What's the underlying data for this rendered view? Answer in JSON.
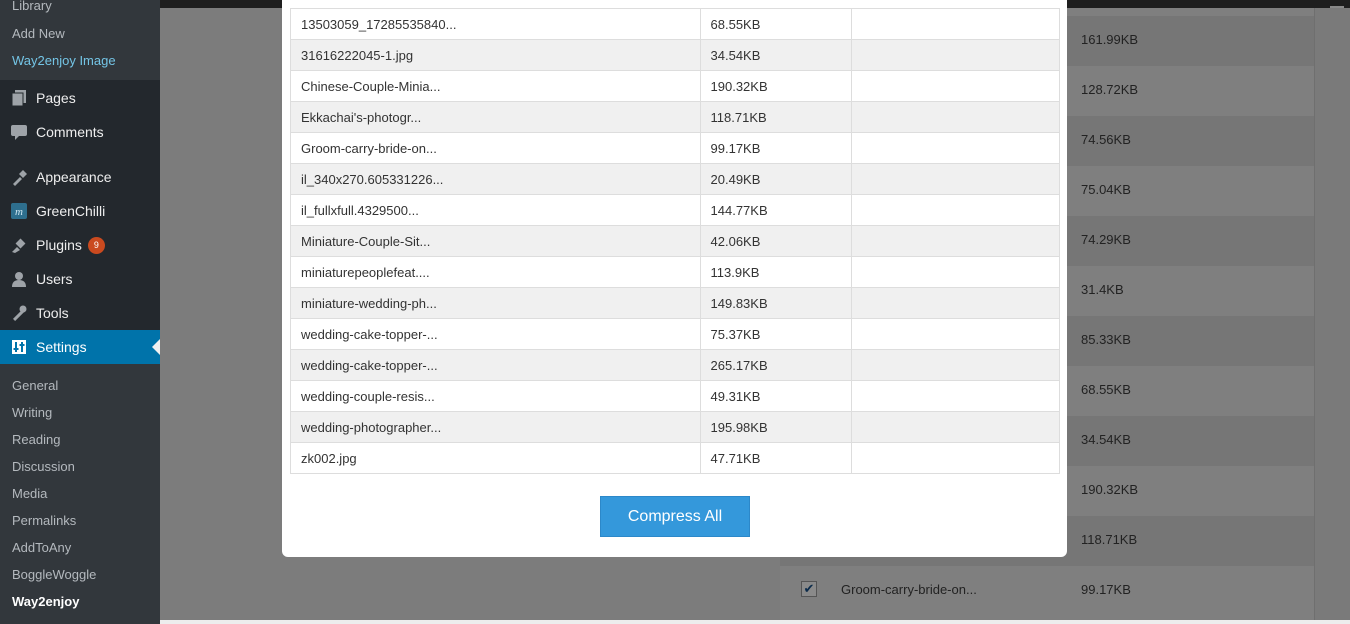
{
  "sidebar": {
    "media_sub": [
      "Library",
      "Add New",
      "Way2enjoy Image"
    ],
    "menu": [
      {
        "label": "Pages",
        "icon": "pages-icon"
      },
      {
        "label": "Comments",
        "icon": "comments-icon"
      },
      {
        "label": "Appearance",
        "icon": "appearance-icon"
      },
      {
        "label": "GreenChilli",
        "icon": "greenchilli-icon"
      },
      {
        "label": "Plugins",
        "icon": "plugins-icon",
        "badge": "9"
      },
      {
        "label": "Users",
        "icon": "users-icon"
      },
      {
        "label": "Tools",
        "icon": "tools-icon"
      },
      {
        "label": "Settings",
        "icon": "settings-icon",
        "active": true
      }
    ],
    "settings_sub": [
      "General",
      "Writing",
      "Reading",
      "Discussion",
      "Media",
      "Permalinks",
      "AddToAny",
      "BoggleWoggle",
      "Way2enjoy"
    ]
  },
  "modal": {
    "files": [
      {
        "name": "13503059_17285535840...",
        "size": "68.55KB",
        "status": ""
      },
      {
        "name": "31616222045-1.jpg",
        "size": "34.54KB",
        "status": ""
      },
      {
        "name": "Chinese-Couple-Minia...",
        "size": "190.32KB",
        "status": ""
      },
      {
        "name": "Ekkachai's-photogr...",
        "size": "118.71KB",
        "status": ""
      },
      {
        "name": "Groom-carry-bride-on...",
        "size": "99.17KB",
        "status": ""
      },
      {
        "name": "il_340x270.605331226...",
        "size": "20.49KB",
        "status": ""
      },
      {
        "name": "il_fullxfull.4329500...",
        "size": "144.77KB",
        "status": ""
      },
      {
        "name": "Miniature-Couple-Sit...",
        "size": "42.06KB",
        "status": ""
      },
      {
        "name": "miniaturepeoplefeat....",
        "size": "113.9KB",
        "status": ""
      },
      {
        "name": "miniature-wedding-ph...",
        "size": "149.83KB",
        "status": ""
      },
      {
        "name": "wedding-cake-topper-...",
        "size": "75.37KB",
        "status": ""
      },
      {
        "name": "wedding-cake-topper-...",
        "size": "265.17KB",
        "status": ""
      },
      {
        "name": "wedding-couple-resis...",
        "size": "49.31KB",
        "status": ""
      },
      {
        "name": "wedding-photographer...",
        "size": "195.98KB",
        "status": ""
      },
      {
        "name": "zk002.jpg",
        "size": "47.71KB",
        "status": ""
      }
    ],
    "compress_all_label": "Compress All"
  },
  "background_table": {
    "rows": [
      {
        "size": "161.99KB",
        "name": "",
        "checked": false
      },
      {
        "size": "128.72KB",
        "name": "",
        "checked": false
      },
      {
        "size": "74.56KB",
        "name": "",
        "checked": false
      },
      {
        "size": "75.04KB",
        "name": "",
        "checked": false
      },
      {
        "size": "74.29KB",
        "name": "",
        "checked": false
      },
      {
        "size": "31.4KB",
        "name": "",
        "checked": false
      },
      {
        "size": "85.33KB",
        "name": "",
        "checked": false
      },
      {
        "size": "68.55KB",
        "name": "",
        "checked": false
      },
      {
        "size": "34.54KB",
        "name": "",
        "checked": false
      },
      {
        "size": "190.32KB",
        "name": "",
        "checked": false
      },
      {
        "size": "118.71KB",
        "name": "",
        "checked": false
      },
      {
        "size": "99.17KB",
        "name": "Groom-carry-bride-on...",
        "checked": true
      }
    ]
  },
  "colors": {
    "sidebar_bg": "#23282d",
    "submenu_bg": "#32373c",
    "active_menu": "#0073aa",
    "plugin_badge": "#ca4a1f",
    "button_blue": "#3498db"
  }
}
